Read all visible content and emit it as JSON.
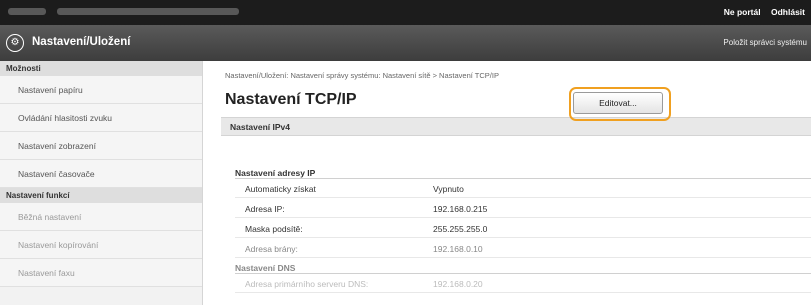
{
  "topbar": {
    "user_link": "Ne portál",
    "logout_link": "Odhlásit"
  },
  "app": {
    "logo_glyph": "⚙",
    "title": "Nastavení/Uložení",
    "manager_mode": "Položit správci systému"
  },
  "sidebar": {
    "section1_title": "Možnosti",
    "items1": [
      {
        "label": "Nastavení papíru"
      },
      {
        "label": "Ovládání hlasitosti zvuku"
      },
      {
        "label": "Nastavení zobrazení"
      },
      {
        "label": "Nastavení časovače"
      }
    ],
    "section2_title": "Nastavení funkcí",
    "items2": [
      {
        "label": "Běžná nastavení"
      },
      {
        "label": "Nastavení kopírování"
      },
      {
        "label": "Nastavení faxu"
      }
    ]
  },
  "main": {
    "breadcrumb": "Nastavení/Uložení: Nastavení správy systému: Nastavení sítě > Nastavení TCP/IP",
    "page_title": "Nastavení TCP/IP",
    "section_title": "Nastavení IPv4",
    "edit_button": "Editovat...",
    "ip_group": "Nastavení adresy IP",
    "ip_rows": [
      {
        "label": "Automaticky získat",
        "value": "Vypnuto"
      },
      {
        "label": "Adresa IP:",
        "value": "192.168.0.215"
      },
      {
        "label": "Maska podsítě:",
        "value": "255.255.255.0"
      },
      {
        "label": "Adresa brány:",
        "value": "192.168.0.10"
      }
    ],
    "dns_group": "Nastavení DNS",
    "dns_rows": [
      {
        "label": "Adresa primárního serveru DNS:",
        "value": "192.168.0.20"
      }
    ]
  }
}
